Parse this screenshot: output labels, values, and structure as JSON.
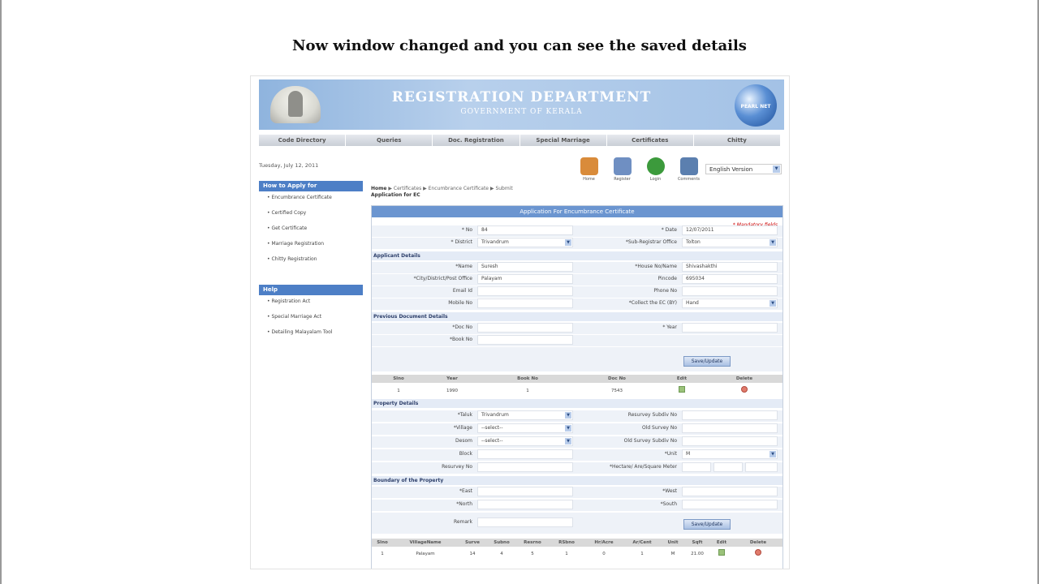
{
  "caption": "Now window changed and you can see the saved details",
  "banner": {
    "title": "REGISTRATION DEPARTMENT",
    "subtitle": "GOVERNMENT OF KERALA",
    "logo_text": "PEARL NET"
  },
  "menu": [
    "Code Directory",
    "Queries",
    "Doc. Registration",
    "Special Marriage",
    "Certificates",
    "Chitty"
  ],
  "date": "Tuesday, July 12, 2011",
  "tools": [
    {
      "label": "Home",
      "icon": "home-icon",
      "color": "#d98b3a"
    },
    {
      "label": "Register",
      "icon": "register-icon",
      "color": "#6f8fc2"
    },
    {
      "label": "Login",
      "icon": "login-icon",
      "color": "#3c9a3c"
    },
    {
      "label": "Comments",
      "icon": "comments-icon",
      "color": "#5b7faf"
    }
  ],
  "language": "English Version",
  "sidebar": {
    "how_to_apply": "How to Apply for",
    "apply_items": [
      "Encumbrance Certificate",
      "Certified Copy",
      "Get Certificate",
      "Marriage Registration",
      "Chitty Registration"
    ],
    "help": "Help",
    "help_items": [
      "Registration Act",
      "Special Marriage Act",
      "Detailing Malayalam Tool"
    ]
  },
  "breadcrumb": {
    "home": "Home",
    "items": [
      "Certificates",
      "Encumbrance Certificate",
      "Submit"
    ],
    "sub": "Application for EC"
  },
  "form": {
    "title": "Application For Encumbrance Certificate",
    "mandatory": "* Mandatory fields",
    "no_label": "* No",
    "no_value": "84",
    "date_label": "* Date",
    "date_value": "12/07/2011",
    "district_label": "* District",
    "district_value": "Trivandrum",
    "sro_label": "*Sub-Registrar Office",
    "sro_value": "Tolton",
    "applicant_section": "Applicant Details",
    "name_label": "*Name",
    "name_value": "Suresh",
    "house_label": "*House No/Name",
    "house_value": "Shivashakthi",
    "city_label": "*City/District/Post Office",
    "city_value": "Palayam",
    "pincode_label": "Pincode",
    "pincode_value": "695034",
    "email_label": "Email Id",
    "phone_label": "Phone No",
    "mobile_label": "Mobile No",
    "collect_label": "*Collect the EC (BY)",
    "collect_value": "Hand",
    "prev_section": "Previous Document Details",
    "docno_label": "*Doc No",
    "year_label": "* Year",
    "bookno_label": "*Book No",
    "save_update": "Save/Update",
    "doc_table": {
      "headers": [
        "Slno",
        "Year",
        "Book No",
        "Doc No",
        "Edit",
        "Delete"
      ],
      "rows": [
        [
          "1",
          "1990",
          "1",
          "7543"
        ]
      ]
    },
    "property_section": "Property Details",
    "taluk_label": "*Taluk",
    "taluk_value": "Trivandrum",
    "resurvey_subdiv_label": "Resurvey Subdiv No",
    "village_label": "*Village",
    "village_value": "--select--",
    "oldsurvey_label": "Old Survey No",
    "desom_label": "Desom",
    "desom_value": "--select--",
    "oldsurvey_subdiv_label": "Old Survey Subdiv No",
    "block_label": "Block",
    "unit_label": "*Unit",
    "unit_value": "M",
    "resurvey_label": "Resurvey No",
    "hectare_label": "*Hectare/ Are/Square Meter",
    "boundary_section": "Boundary of the Property",
    "east_label": "*East",
    "west_label": "*West",
    "north_label": "*North",
    "south_label": "*South",
    "remark_label": "Remark",
    "prop_table": {
      "headers": [
        "Slno",
        "VillageName",
        "Surve",
        "Subno",
        "Resrno",
        "RSbno",
        "Hr/Acre",
        "Ar/Cent",
        "Unit",
        "Sqft",
        "Edit",
        "Delete"
      ],
      "rows": [
        [
          "1",
          "Palayam",
          "14",
          "4",
          "5",
          "1",
          "0",
          "1",
          "M",
          "21.00"
        ]
      ]
    }
  }
}
